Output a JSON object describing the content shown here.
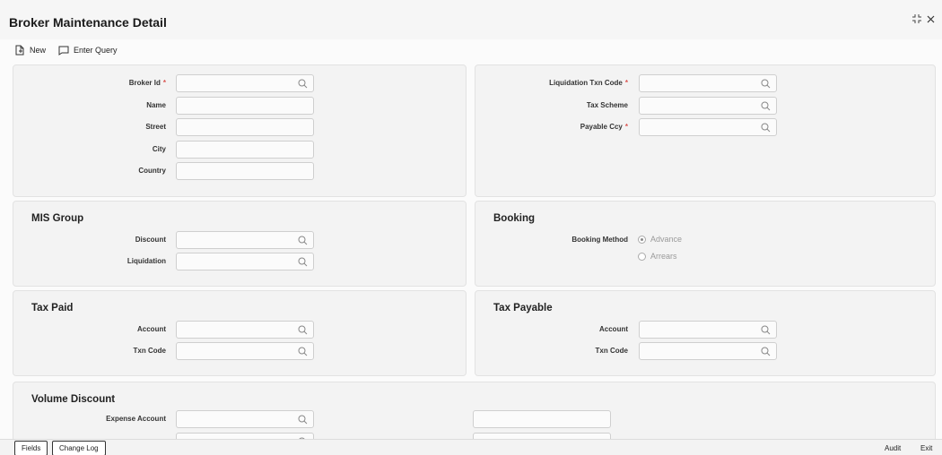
{
  "window": {
    "title": "Broker Maintenance Detail"
  },
  "toolbar": {
    "new_label": "New",
    "enter_query_label": "Enter Query"
  },
  "broker": {
    "broker_id_label": "Broker Id",
    "name_label": "Name",
    "street_label": "Street",
    "city_label": "City",
    "country_label": "Country",
    "required_mark": "*"
  },
  "liquidation": {
    "txn_code_label": "Liquidation Txn Code",
    "tax_scheme_label": "Tax Scheme",
    "payable_ccy_label": "Payable Ccy"
  },
  "mis_group": {
    "title": "MIS Group",
    "discount_label": "Discount",
    "liquidation_label": "Liquidation"
  },
  "booking": {
    "title": "Booking",
    "method_label": "Booking Method",
    "advance_label": "Advance",
    "arrears_label": "Arrears",
    "selected": "Advance"
  },
  "tax_paid": {
    "title": "Tax Paid",
    "account_label": "Account",
    "txn_code_label": "Txn Code"
  },
  "tax_payable": {
    "title": "Tax Payable",
    "account_label": "Account",
    "txn_code_label": "Txn Code"
  },
  "volume_discount": {
    "title": "Volume Discount",
    "expense_account_label": "Expense Account"
  },
  "footer": {
    "fields_label": "Fields",
    "change_log_label": "Change Log",
    "audit_label": "Audit",
    "exit_label": "Exit"
  },
  "colors": {
    "required": "#d9534f",
    "panel_bg": "#f3f3f3"
  }
}
